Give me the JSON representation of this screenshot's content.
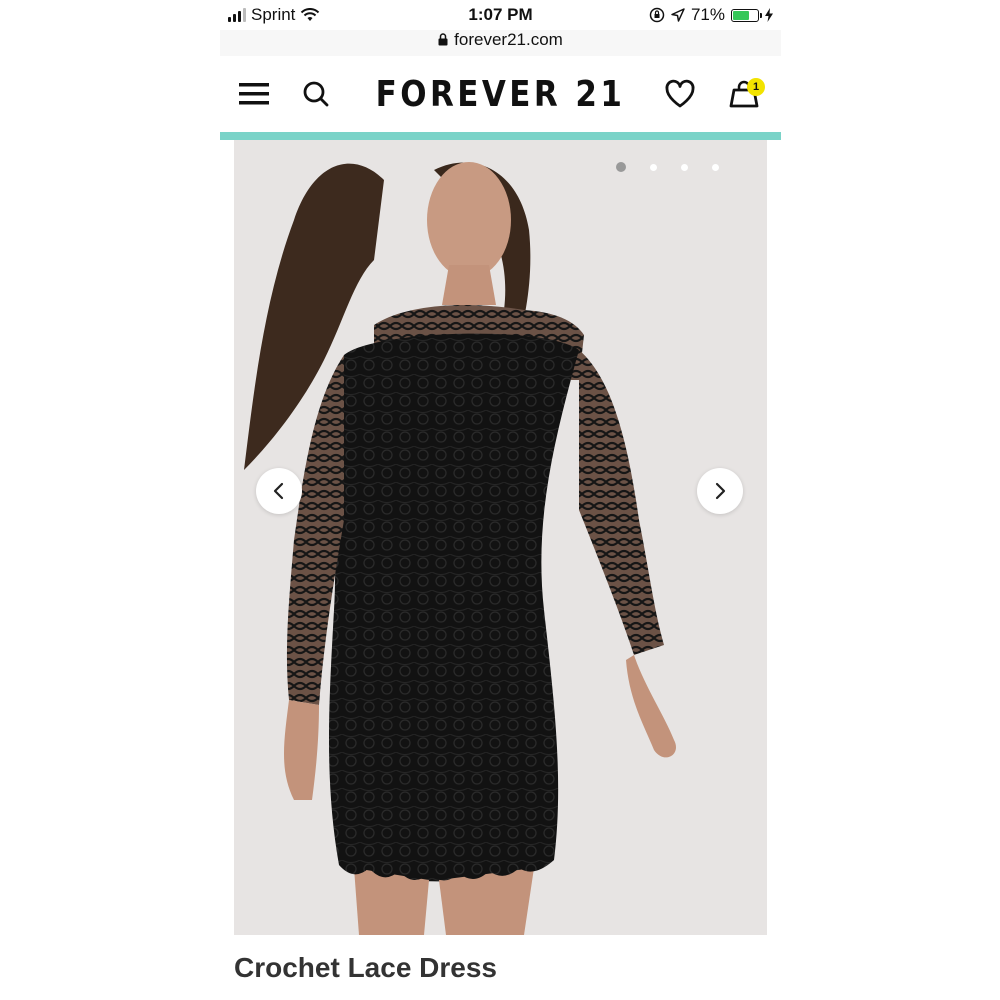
{
  "status_bar": {
    "carrier": "Sprint",
    "time": "1:07 PM",
    "battery_percent": "71%",
    "battery_level": 0.71
  },
  "url_bar": {
    "url": "forever21.com"
  },
  "header": {
    "logo_text": "FOREVER 21",
    "cart_count": "1",
    "accent_color": "#7ad3c8"
  },
  "gallery": {
    "slide_count": 4,
    "active_slide": 1
  },
  "product": {
    "title": "Crochet Lace Dress"
  }
}
